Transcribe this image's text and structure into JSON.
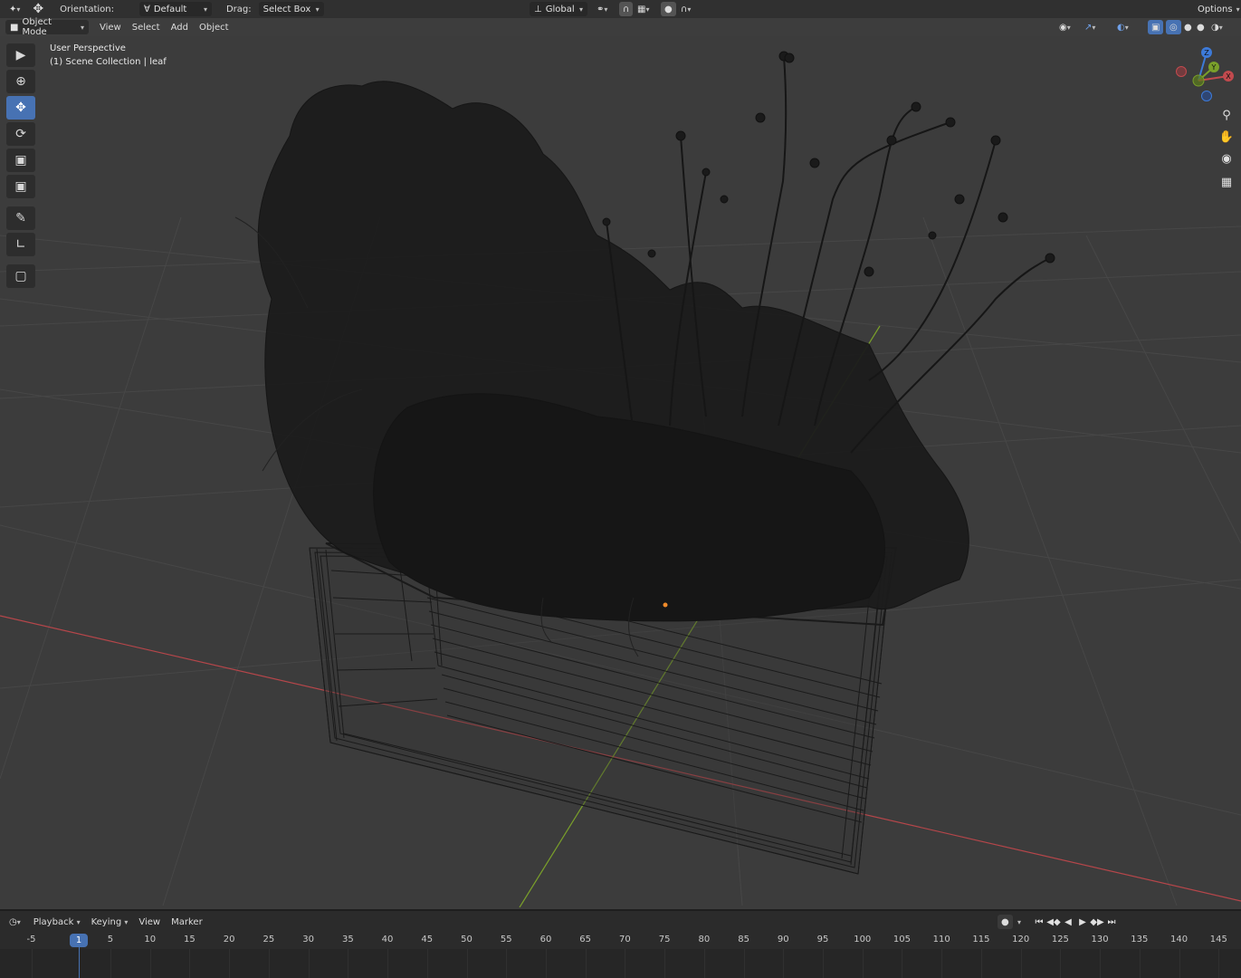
{
  "header": {
    "orientation_label": "Orientation:",
    "orientation_value": "Default",
    "drag_label": "Drag:",
    "drag_value": "Select Box",
    "transform_space": "Global",
    "options_label": "Options"
  },
  "viewport_header": {
    "mode": "Object Mode",
    "menus": [
      "View",
      "Select",
      "Add",
      "Object"
    ]
  },
  "viewport": {
    "perspective_label": "User Perspective",
    "collection_label": "(1) Scene Collection | leaf"
  },
  "gizmo": {
    "z_label": "Z",
    "y_label": "Y",
    "x_label": "X"
  },
  "timeline": {
    "menus": [
      "Playback",
      "Keying",
      "View",
      "Marker"
    ],
    "current_frame": "1",
    "frame_labels": [
      "-5",
      "5",
      "10",
      "15",
      "20",
      "25",
      "30",
      "35",
      "40",
      "45",
      "50",
      "55",
      "60",
      "65",
      "70",
      "75",
      "80",
      "85",
      "90",
      "95",
      "100",
      "105",
      "110",
      "115",
      "120",
      "125",
      "130",
      "135",
      "140",
      "145"
    ]
  },
  "icons": {
    "editor_type": "cursor-icon",
    "transform_pivot": "move-arrows-icon",
    "snapping": "magnet-icon",
    "proportional": "circle-dot-icon"
  },
  "colors": {
    "accent": "#4772b3",
    "x_axis": "#c24a4e",
    "y_axis": "#7aa02a",
    "z_axis": "#3d7ad8"
  }
}
